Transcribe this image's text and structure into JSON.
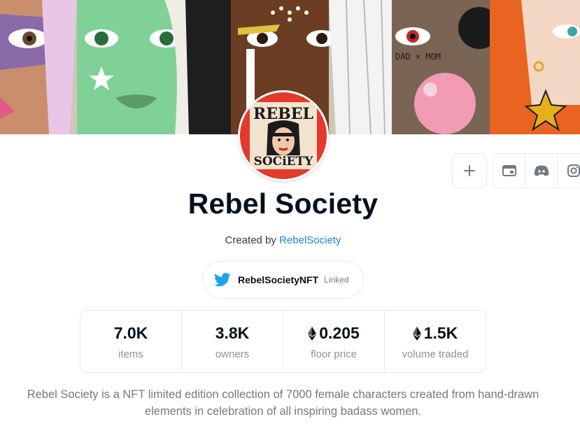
{
  "collection": {
    "name": "Rebel Society",
    "created_by_prefix": "Created by",
    "creator": "RebelSociety",
    "avatar_text_top": "REBEL",
    "avatar_text_bottom": "SOCiETY"
  },
  "actions": {
    "add_icon": "plus-icon",
    "social_icons": [
      "website-icon",
      "discord-icon",
      "instagram-icon"
    ]
  },
  "twitter": {
    "handle": "RebelSocietyNFT",
    "status": "Linked"
  },
  "stats": [
    {
      "value": "7.0K",
      "label": "items",
      "eth": false
    },
    {
      "value": "3.8K",
      "label": "owners",
      "eth": false
    },
    {
      "value": "0.205",
      "label": "floor price",
      "eth": true
    },
    {
      "value": "1.5K",
      "label": "volume traded",
      "eth": true
    }
  ],
  "description": "Rebel Society is a NFT limited edition collection of 7000 female characters created from hand-drawn elements in celebration of all inspiring badass women.",
  "banner_text": "DAD × MOM",
  "colors": {
    "link": "#2081e2",
    "twitter": "#1da1f2",
    "avatar_red": "#e33a2c",
    "border": "#e5e8eb"
  }
}
